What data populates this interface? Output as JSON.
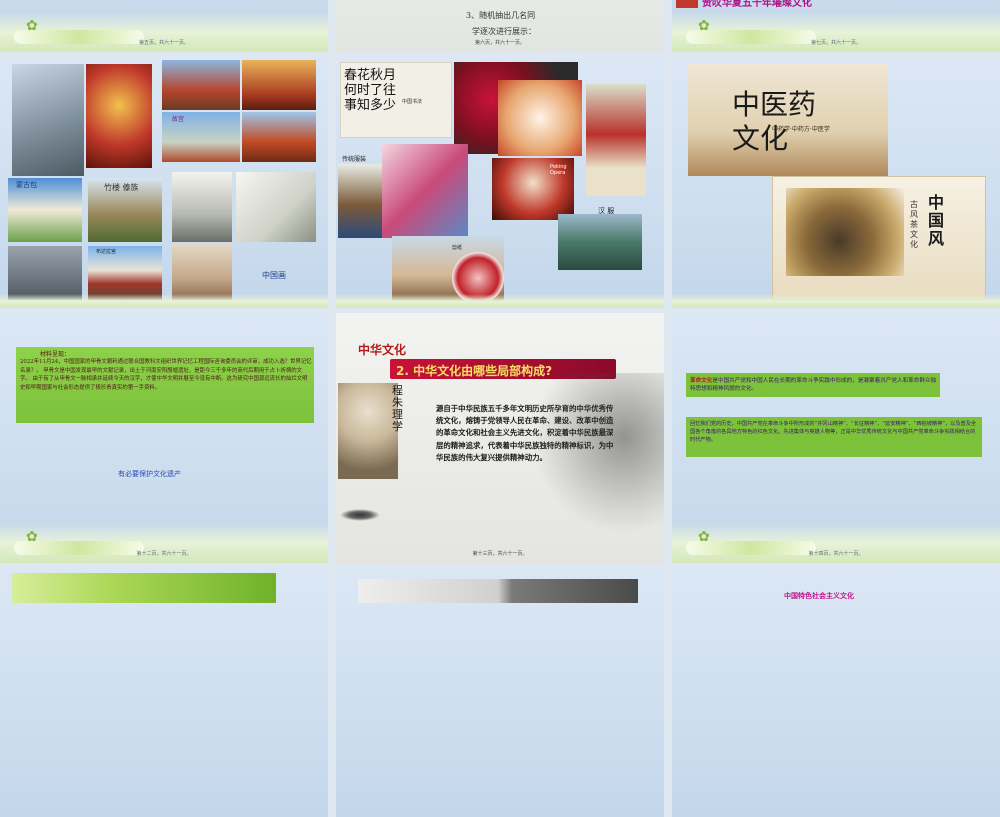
{
  "slide1": {
    "footer": "第五页，共六十一页。"
  },
  "slide2": {
    "steps": [
      "3、随机抽出几名同",
      "学逐次进行展示："
    ],
    "footer": "第六页，共六十一页。"
  },
  "slide3": {
    "title": "赞叹华夏五千年璀璨文化",
    "footer": "第七页，共六十一页。"
  },
  "slide4": {
    "labels": {
      "gugong": "故宫",
      "mengubao": "蒙古包",
      "zhulou": "竹楼 傣族",
      "budala": "布达拉宫",
      "zhongguohua": "中国画"
    }
  },
  "slide5": {
    "labels": {
      "shufa": "中国书法",
      "fushi": "传统服装",
      "jingju": "Peking Opera",
      "hanfu": "汉 服",
      "jianzhi": "剪纸"
    }
  },
  "slide6": {
    "zhongyi": "中医药文化",
    "zhongyi_sub": "中药学·中药方·中医学",
    "cha_title": "中国风",
    "cha_sub": "古风茶文化"
  },
  "slide7": {
    "heading": "材料呈现：",
    "paragraph": "2022年11月24，中国国家的甲骨文顺利通过联合国教科文组织世界记忆工程国际咨询委员会的评审，成功入选？世界记忆名录？。 甲骨文是中国发现最早的文献记录，出土于河南安阳殷墟遗址，是距今三千多年的商代后期用于占卜祈祷的文字。 由于有了从甲骨文一脉相承并延续今天的汉字，才使中华文明并展至今没有中断。这为研究中国源远流长的灿烂文明史和早期国家与社会形态提供了极珍贵真实的第一手资料。",
    "question": "有必要保护文化遗产",
    "footer": "第十二页，共六十一页。"
  },
  "slide8": {
    "brand": "中华文化",
    "question": "2. 中华文化由哪些局部构成?",
    "figure": "程朱理学",
    "body": "源自于中华民族五千多年文明历史所孕育的中华优秀传统文化，熔铸于党领导人民在革命、建设、改革中创造的革命文化和社会主义先进文化，积淀着中华民族最深层的精神追求，代表着中华民族独特的精神标识，为中华民族的伟大复兴提供精神动力。",
    "footer": "第十三页，共六十一页。"
  },
  "slide9": {
    "term": "革命文化",
    "definition": "是中国共产党和中国人民在长期的革命斗争实践中形成的，是凝聚着共产党人和革命群众独特思想和精神风貌的文化。",
    "text1": "回忆我们党的历史，中国共产党在革命斗争中所形成的“井冈山精神”、“长征精神”、“延安精神”、“西柏坡精神”，以及普及全国各个角落的各具地方特色的红色文化。先进集体与英雄人物等，正是中华优秀传统文化与中国共产党革命斗争实践相结合的时代产物。",
    "footer": "第十四页，共六十一页。"
  },
  "slide12": {
    "title": "中国特色社会主义文化"
  }
}
